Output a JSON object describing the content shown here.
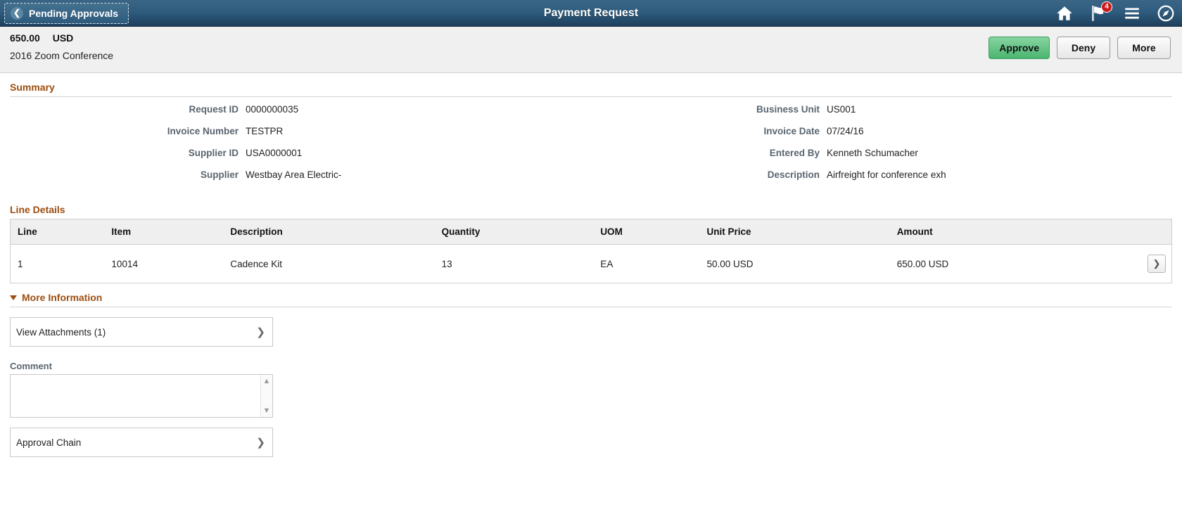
{
  "titlebar": {
    "back_label": "Pending Approvals",
    "back_icon": "chevron-left-icon",
    "title": "Payment Request",
    "icons": [
      {
        "name": "home-icon",
        "badge": null
      },
      {
        "name": "flag-notification-icon",
        "badge": "4"
      },
      {
        "name": "hamburger-menu-icon",
        "badge": null
      },
      {
        "name": "compass-navigator-icon",
        "badge": null
      }
    ]
  },
  "subheader": {
    "amount": "650.00",
    "currency": "USD",
    "subtitle": "2016 Zoom Conference",
    "buttons": {
      "approve": "Approve",
      "deny": "Deny",
      "more": "More"
    }
  },
  "summary": {
    "heading": "Summary",
    "left": [
      {
        "label": "Request ID",
        "value": "0000000035"
      },
      {
        "label": "Invoice Number",
        "value": "TESTPR"
      },
      {
        "label": "Supplier ID",
        "value": "USA0000001"
      },
      {
        "label": "Supplier",
        "value": "Westbay Area Electric-"
      }
    ],
    "right": [
      {
        "label": "Business Unit",
        "value": "US001"
      },
      {
        "label": "Invoice Date",
        "value": "07/24/16"
      },
      {
        "label": "Entered By",
        "value": "Kenneth Schumacher"
      },
      {
        "label": "Description",
        "value": "Airfreight for conference exh"
      }
    ]
  },
  "line_details": {
    "heading": "Line Details",
    "columns": [
      "Line",
      "Item",
      "Description",
      "Quantity",
      "UOM",
      "Unit Price",
      "Amount"
    ],
    "rows": [
      {
        "line": "1",
        "item": "10014",
        "description": "Cadence Kit",
        "quantity": "13",
        "uom": "EA",
        "unit_price": "50.00 USD",
        "amount": "650.00 USD",
        "detail_icon": "chevron-right-icon"
      }
    ]
  },
  "more_information": {
    "heading": "More Information",
    "caret_icon": "caret-down-icon",
    "attachments_label": "View Attachments (1)",
    "attachments_icon": "chevron-right-icon",
    "comment_label": "Comment",
    "comment_value": "",
    "comment_placeholder": "",
    "scroll_up_icon": "scroll-up-icon",
    "scroll_down_icon": "scroll-down-icon",
    "approval_chain_label": "Approval Chain",
    "approval_chain_icon": "chevron-right-icon"
  },
  "colors": {
    "titlebar_dark": "#1d3f5c",
    "titlebar_light": "#3a6585",
    "section_heading": "#9c4d10",
    "approve_green": "#4cb571",
    "badge_red": "#cc1b1b",
    "field_label": "#5a6570"
  }
}
